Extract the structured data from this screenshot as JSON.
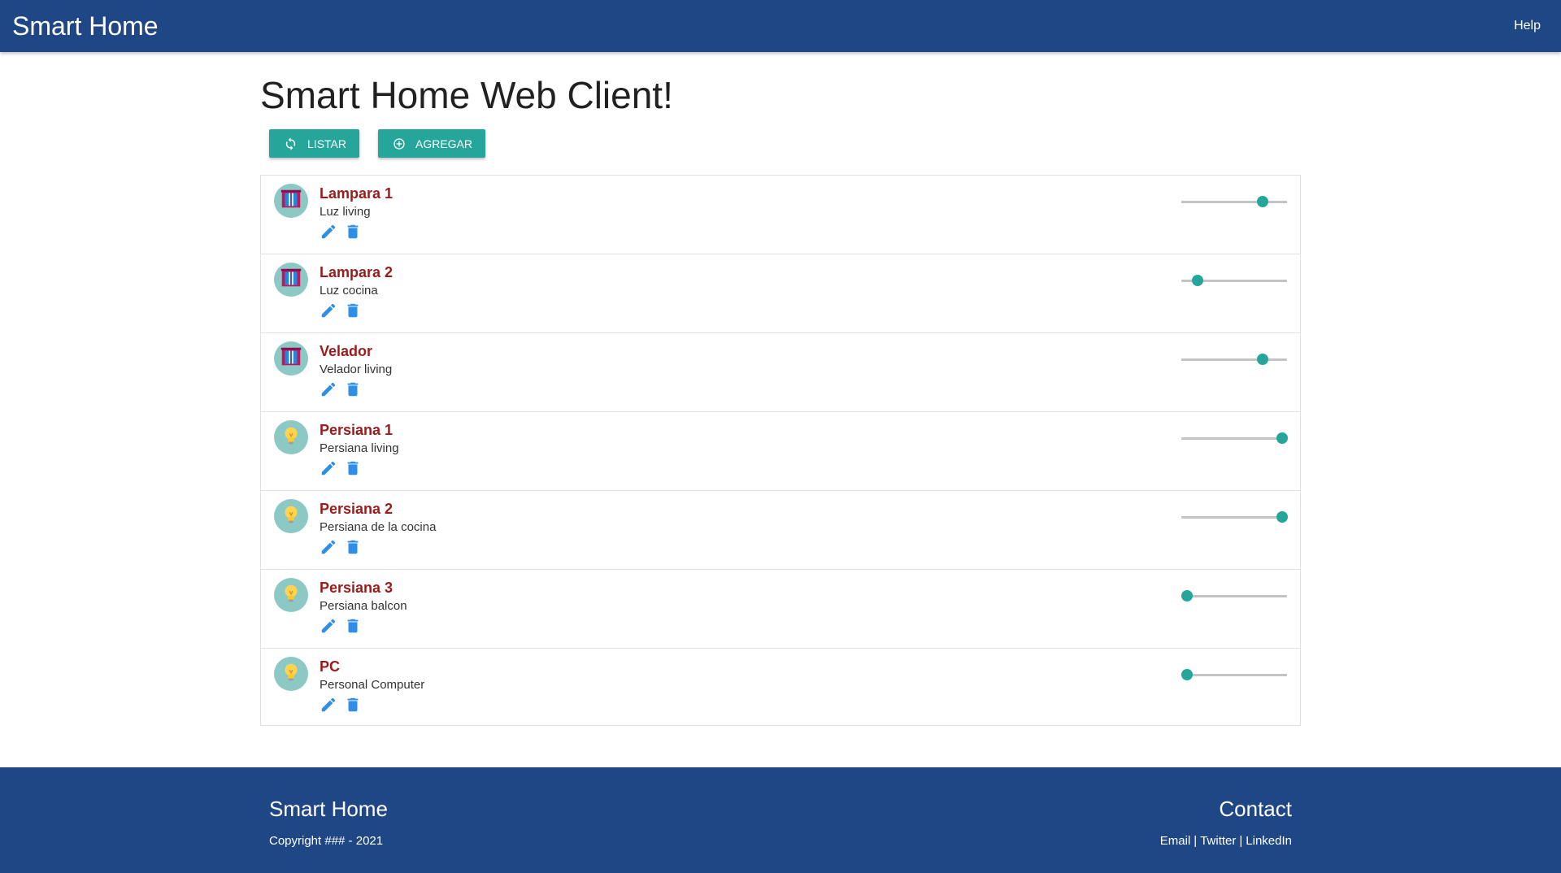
{
  "navbar": {
    "brand": "Smart Home",
    "help_label": "Help"
  },
  "main": {
    "title": "Smart Home Web Client!",
    "buttons": {
      "listar": "LISTAR",
      "agregar": "AGREGAR"
    }
  },
  "devices": [
    {
      "name": "Lampara 1",
      "description": "Luz living",
      "icon": "window-icon",
      "level": 0.77
    },
    {
      "name": "Lampara 2",
      "description": "Luz cocina",
      "icon": "window-icon",
      "level": 0.15
    },
    {
      "name": "Velador",
      "description": "Velador living",
      "icon": "window-icon",
      "level": 0.77
    },
    {
      "name": "Persiana 1",
      "description": "Persiana living",
      "icon": "lightbulb-icon",
      "level": 0.95
    },
    {
      "name": "Persiana 2",
      "description": "Persiana de la cocina",
      "icon": "lightbulb-icon",
      "level": 0.95
    },
    {
      "name": "Persiana 3",
      "description": "Persiana balcon",
      "icon": "lightbulb-icon",
      "level": 0.05
    },
    {
      "name": "PC",
      "description": "Personal Computer",
      "icon": "lightbulb-icon",
      "level": 0.05
    }
  ],
  "footer": {
    "brand": "Smart Home",
    "copyright": "Copyright ### - 2021",
    "contact_title": "Contact",
    "links": [
      "Email",
      "Twitter",
      "LinkedIn"
    ],
    "separator": "|"
  },
  "colors": {
    "primary": "#1f4785",
    "accent": "#26a69a",
    "item_title": "#9b1b1b",
    "action_icon": "#2f8fe6"
  }
}
